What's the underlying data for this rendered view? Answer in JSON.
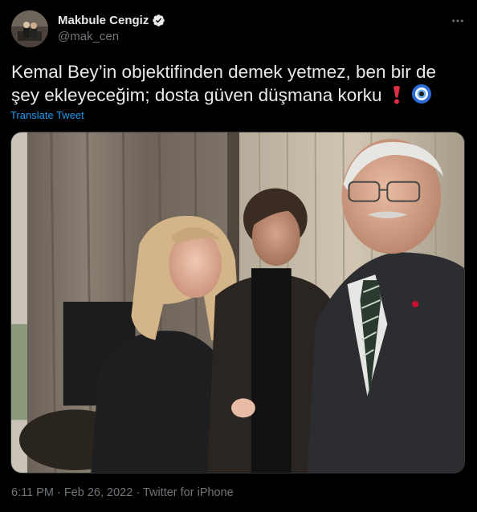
{
  "author": {
    "display_name": "Makbule Cengiz",
    "handle": "@mak_cen",
    "verified": true
  },
  "tweet": {
    "text_line1": "Kemal Bey’in objektifinden demek yetmez, ben bir de",
    "text_line2": "şey ekleyeceğim; dosta güven düşmana korku",
    "emojis": [
      "heavy-exclamation-icon",
      "nazar-amulet-icon"
    ],
    "translate_label": "Translate Tweet"
  },
  "meta": {
    "time": "6:11 PM",
    "separator1": " · ",
    "date": "Feb 26, 2022",
    "separator2": " · ",
    "source": "Twitter for iPhone"
  },
  "colors": {
    "background": "#000000",
    "text": "#e7e9ea",
    "muted": "#71767b",
    "link": "#1d9bf0",
    "verified": "#e7e9ea"
  }
}
